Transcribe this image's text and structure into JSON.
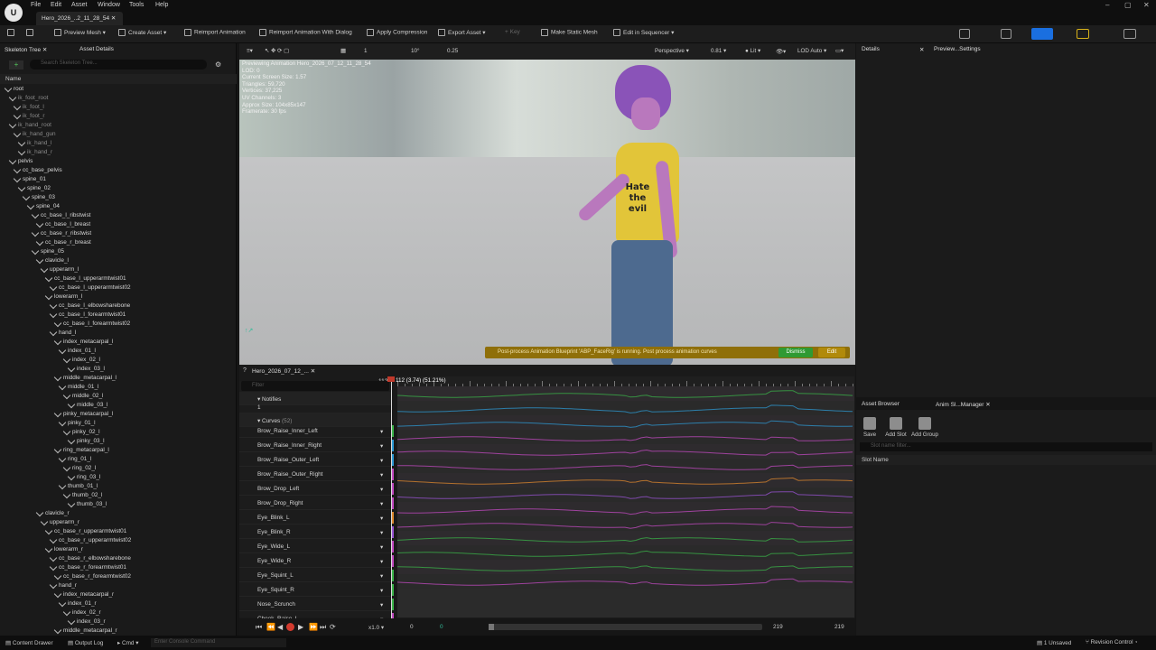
{
  "app": {
    "logo_label": "U",
    "menu": [
      "File",
      "Edit",
      "Asset",
      "Window",
      "Tools",
      "Help"
    ],
    "doc_tab": "Hero_2026_..2_11_28_54"
  },
  "window_controls": {
    "minimize": "–",
    "maximize": "▢",
    "close": "✕"
  },
  "toolbar": {
    "buttons": [
      "Preview Mesh",
      "Create Asset",
      "Reimport Animation",
      "Reimport Animation With Dialog",
      "Apply Compression",
      "Export Asset",
      "Key",
      "Make Static Mesh",
      "Edit in Sequencer"
    ],
    "accent": "#1a6fe0"
  },
  "left_panel": {
    "tabs": [
      "Skeleton Tree",
      "Asset Details"
    ],
    "search_placeholder": "Search Skeleton Tree...",
    "column_header": "Name",
    "bones": [
      {
        "n": "root",
        "d": 0,
        "dim": false
      },
      {
        "n": "ik_foot_root",
        "d": 1,
        "dim": true
      },
      {
        "n": "ik_foot_l",
        "d": 2,
        "dim": true
      },
      {
        "n": "ik_foot_r",
        "d": 2,
        "dim": true
      },
      {
        "n": "ik_hand_root",
        "d": 1,
        "dim": true
      },
      {
        "n": "ik_hand_gun",
        "d": 2,
        "dim": true
      },
      {
        "n": "ik_hand_l",
        "d": 3,
        "dim": true
      },
      {
        "n": "ik_hand_r",
        "d": 3,
        "dim": true
      },
      {
        "n": "pelvis",
        "d": 1,
        "dim": false
      },
      {
        "n": "cc_base_pelvis",
        "d": 2,
        "dim": false
      },
      {
        "n": "spine_01",
        "d": 2,
        "dim": false
      },
      {
        "n": "spine_02",
        "d": 3,
        "dim": false
      },
      {
        "n": "spine_03",
        "d": 4,
        "dim": false
      },
      {
        "n": "spine_04",
        "d": 5,
        "dim": false
      },
      {
        "n": "cc_base_l_ribstwist",
        "d": 6,
        "dim": false
      },
      {
        "n": "cc_base_l_breast",
        "d": 7,
        "dim": false
      },
      {
        "n": "cc_base_r_ribstwist",
        "d": 6,
        "dim": false
      },
      {
        "n": "cc_base_r_breast",
        "d": 7,
        "dim": false
      },
      {
        "n": "spine_05",
        "d": 6,
        "dim": false
      },
      {
        "n": "clavicle_l",
        "d": 7,
        "dim": false
      },
      {
        "n": "upperarm_l",
        "d": 8,
        "dim": false
      },
      {
        "n": "cc_base_l_upperarmtwist01",
        "d": 9,
        "dim": false
      },
      {
        "n": "cc_base_l_upperarmtwist02",
        "d": 10,
        "dim": false
      },
      {
        "n": "lowerarm_l",
        "d": 9,
        "dim": false
      },
      {
        "n": "cc_base_l_elbowsharebone",
        "d": 10,
        "dim": false
      },
      {
        "n": "cc_base_l_forearmtwist01",
        "d": 10,
        "dim": false
      },
      {
        "n": "cc_base_l_forearmtwist02",
        "d": 11,
        "dim": false
      },
      {
        "n": "hand_l",
        "d": 10,
        "dim": false
      },
      {
        "n": "index_metacarpal_l",
        "d": 11,
        "dim": false
      },
      {
        "n": "index_01_l",
        "d": 12,
        "dim": false
      },
      {
        "n": "index_02_l",
        "d": 13,
        "dim": false
      },
      {
        "n": "index_03_l",
        "d": 14,
        "dim": false
      },
      {
        "n": "middle_metacarpal_l",
        "d": 11,
        "dim": false
      },
      {
        "n": "middle_01_l",
        "d": 12,
        "dim": false
      },
      {
        "n": "middle_02_l",
        "d": 13,
        "dim": false
      },
      {
        "n": "middle_03_l",
        "d": 14,
        "dim": false
      },
      {
        "n": "pinky_metacarpal_l",
        "d": 11,
        "dim": false
      },
      {
        "n": "pinky_01_l",
        "d": 12,
        "dim": false
      },
      {
        "n": "pinky_02_l",
        "d": 13,
        "dim": false
      },
      {
        "n": "pinky_03_l",
        "d": 14,
        "dim": false
      },
      {
        "n": "ring_metacarpal_l",
        "d": 11,
        "dim": false
      },
      {
        "n": "ring_01_l",
        "d": 12,
        "dim": false
      },
      {
        "n": "ring_02_l",
        "d": 13,
        "dim": false
      },
      {
        "n": "ring_03_l",
        "d": 14,
        "dim": false
      },
      {
        "n": "thumb_01_l",
        "d": 12,
        "dim": false
      },
      {
        "n": "thumb_02_l",
        "d": 13,
        "dim": false
      },
      {
        "n": "thumb_03_l",
        "d": 14,
        "dim": false
      },
      {
        "n": "clavicle_r",
        "d": 7,
        "dim": false
      },
      {
        "n": "upperarm_r",
        "d": 8,
        "dim": false
      },
      {
        "n": "cc_base_r_upperarmtwist01",
        "d": 9,
        "dim": false
      },
      {
        "n": "cc_base_r_upperarmtwist02",
        "d": 10,
        "dim": false
      },
      {
        "n": "lowerarm_r",
        "d": 9,
        "dim": false
      },
      {
        "n": "cc_base_r_elbowsharebone",
        "d": 10,
        "dim": false
      },
      {
        "n": "cc_base_r_forearmtwist01",
        "d": 10,
        "dim": false
      },
      {
        "n": "cc_base_r_forearmtwist02",
        "d": 11,
        "dim": false
      },
      {
        "n": "hand_r",
        "d": 10,
        "dim": false
      },
      {
        "n": "index_metacarpal_r",
        "d": 11,
        "dim": false
      },
      {
        "n": "index_01_r",
        "d": 12,
        "dim": false
      },
      {
        "n": "index_02_r",
        "d": 13,
        "dim": false
      },
      {
        "n": "index_03_r",
        "d": 14,
        "dim": false
      },
      {
        "n": "middle_metacarpal_r",
        "d": 11,
        "dim": false
      }
    ]
  },
  "viewport": {
    "toolbar": [
      "Perspective",
      "0.81",
      "Lit",
      "LOD Auto"
    ],
    "snap": [
      "1",
      "10°",
      "0.25"
    ],
    "stats": [
      "Previewing Animation Hero_2026_07_12_11_28_54",
      "LOD: 0",
      "Current Screen Size: 1.57",
      "Triangles: 59,720",
      "Vertices: 37,225",
      "UV Channels: 3",
      "Approx Size: 104x85x147",
      "Framerate: 30 fps"
    ],
    "shirt_text": [
      "Hate",
      "the",
      "evil"
    ],
    "warning": "Post-process Animation Blueprint 'ABP_FaceRig' is running. Post process animation curves",
    "warn_dismiss": "Dismiss",
    "warn_edit": "Edit"
  },
  "timeline": {
    "tab": "Hero_2026_07_12_...",
    "frame_field": "112",
    "filter_placeholder": "Filter",
    "notifies_label": "Notifies",
    "notify_track": "1",
    "curves_label": "Curves",
    "curves_count": "(52)",
    "scrub_label": "112 (3.74) (51.21%)",
    "playback_speed": "x1.0",
    "range_start": "0",
    "range_start2": "0",
    "range_end": "219",
    "range_end2": "219",
    "playback_fraction": 0.512,
    "curves": [
      {
        "name": "Brow_Raise_Inner_Left",
        "color": "#3bb54a"
      },
      {
        "name": "Brow_Raise_Inner_Right",
        "color": "#2d9bd6"
      },
      {
        "name": "Brow_Raise_Outer_Left",
        "color": "#2d9bd6"
      },
      {
        "name": "Brow_Raise_Outer_Right",
        "color": "#c44bc3"
      },
      {
        "name": "Brow_Drop_Left",
        "color": "#c44bc3"
      },
      {
        "name": "Brow_Drop_Right",
        "color": "#c44bc3"
      },
      {
        "name": "Eye_Blink_L",
        "color": "#e08a2e"
      },
      {
        "name": "Eye_Blink_R",
        "color": "#9b54d6"
      },
      {
        "name": "Eye_Wide_L",
        "color": "#c44bc3"
      },
      {
        "name": "Eye_Wide_R",
        "color": "#c44bc3"
      },
      {
        "name": "Eye_Squint_L",
        "color": "#3bb54a"
      },
      {
        "name": "Eye_Squint_R",
        "color": "#3bb54a"
      },
      {
        "name": "Nose_Scrunch",
        "color": "#3bb54a"
      },
      {
        "name": "Cheek_Raise_L",
        "color": "#c44bc3"
      }
    ]
  },
  "details_panel": {
    "tabs": [
      "Details",
      "Preview...Settings"
    ]
  },
  "asset_panel": {
    "tabs": [
      "Asset Browser",
      "Anim Sl...Manager"
    ],
    "buttons": [
      "Save",
      "Add Slot",
      "Add Group"
    ],
    "filter_placeholder": "Slot name filter...",
    "column": "Slot Name"
  },
  "statusbar": {
    "content_drawer": "Content Drawer",
    "output_log": "Output Log",
    "cmd": "Cmd",
    "console_placeholder": "Enter Console Command",
    "unsaved": "1 Unsaved",
    "revision": "Revision Control"
  }
}
